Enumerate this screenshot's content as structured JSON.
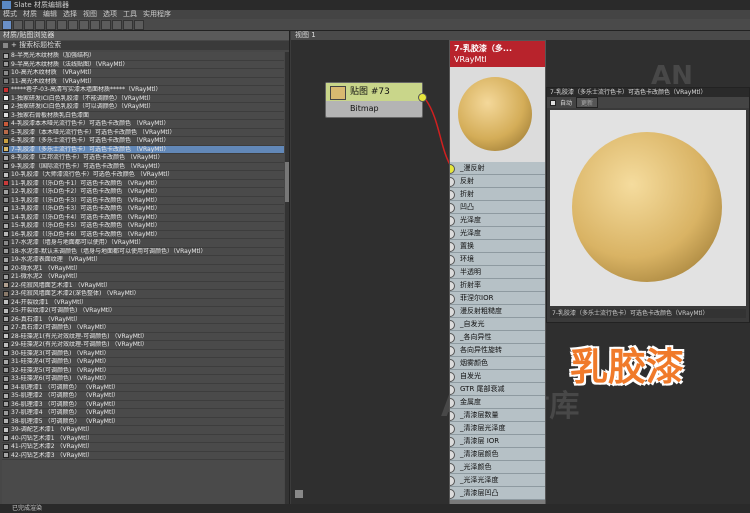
{
  "window": {
    "title": "Slate 材质编辑器"
  },
  "menu": [
    "模式",
    "材质",
    "编辑",
    "选择",
    "视图",
    "选项",
    "工具",
    "实用程序"
  ],
  "left_panel": {
    "title": "材质/贴图浏览器",
    "section": "+ 搜索标题检索",
    "items": [
      {
        "label": "8-半亮光木纹材质（加强结构）",
        "swatch": "#aaaaaa"
      },
      {
        "label": "9-半高光木纹材质（法线贴图）（VRayMtl）",
        "swatch": "#999999"
      },
      {
        "label": "10-高光木纹材质 （VRayMtl）",
        "swatch": "#8a8a8a"
      },
      {
        "label": "11-高光木纹材质 （VRayMtl）",
        "swatch": "#7a7a7a"
      },
      {
        "label": "*****巷子-03-高清写实漆木墙面材质*****（VRayMtl）",
        "swatch": "#c83030"
      },
      {
        "label": "1-独家研发ICI白色乳胶漆（不能调颜色）（VRayMtl）",
        "swatch": "#eeeeee"
      },
      {
        "label": "2-独家研发ICI白色乳胶漆（可以调颜色）（VRayMtl）",
        "swatch": "#e4e4e4"
      },
      {
        "label": "3-独家石膏板材质乳白色漆面",
        "swatch": "#dddddd"
      },
      {
        "label": "4-乳胶漆本木哑光流行色卡）可选色卡改颜色 （VRayMtl）",
        "swatch": "#c85a3a"
      },
      {
        "label": "5-乳胶漆（本木哑光流行色卡）可选色卡改颜色 （VRayMtl）",
        "swatch": "#b86a4a"
      },
      {
        "label": "6-乳胶漆（多乐士流行色卡）可选色卡改颜色 （VRayMtl）",
        "swatch": "#c9a040"
      },
      {
        "label": "7-乳胶漆（多乐士流行色卡）可选色卡改颜色 （VRayMtl）",
        "swatch": "#d8b868",
        "selected": true
      },
      {
        "label": "8-乳胶漆（立邦流行色卡）可选色卡改颜色 （VRayMtl）",
        "swatch": "#a8a8a8"
      },
      {
        "label": "9-乳胶漆（国际流行色卡）可选色卡改颜色 （VRayMtl）",
        "swatch": "#b0b0b0"
      },
      {
        "label": "10-乳胶漆（大师漆流行色卡）可选色卡改颜色 （VRayMtl）",
        "swatch": "#c0c0c0"
      },
      {
        "label": "11-乳胶漆（（乐D色卡1）可选色卡改颜色 （VRayMtl）",
        "swatch": "#c83a3a"
      },
      {
        "label": "12-乳胶漆（（乐D色卡2）可选色卡改颜色 （VRayMtl）",
        "swatch": "#a0a0a0"
      },
      {
        "label": "13-乳胶漆（（乐D色卡3）可选色卡改颜色 （VRayMtl）",
        "swatch": "#909090"
      },
      {
        "label": "13-乳胶漆（（乐D色卡3）可选色卡改颜色 （VRayMtl）",
        "swatch": "#bbbbbb"
      },
      {
        "label": "14-乳胶漆（（乐D色卡4）可选色卡改颜色 （VRayMtl）",
        "swatch": "#9a9a9a"
      },
      {
        "label": "15-乳胶漆（（乐D色卡5）可选色卡改颜色 （VRayMtl）",
        "swatch": "#aaaaaa"
      },
      {
        "label": "16-乳胶漆（（乐D色卡6）可选色卡改颜色 （VRayMtl）",
        "swatch": "#b8b8b8"
      },
      {
        "label": "17-水泥漆（墙身与地面都可以使用）（VRayMtl）",
        "swatch": "#888888"
      },
      {
        "label": "18-水泥漆-默认未调颜色（墙身与地面都可以使用可调颜色）（VRayMtl）",
        "swatch": "#999999"
      },
      {
        "label": "19-水泥漆表面纹理 （VRayMtl）",
        "swatch": "#a5a5a5"
      },
      {
        "label": "20-微水泥1 （VRayMtl）",
        "swatch": "#aaaaaa"
      },
      {
        "label": "21-微水泥2 （VRayMtl）",
        "swatch": "#9e9e9e"
      },
      {
        "label": "22-侘寂风墙面艺术漆1 （VRayMtl）",
        "swatch": "#b0a090"
      },
      {
        "label": "23-侘寂风墙面艺术漆2(深色整体) （VRayMtl）",
        "swatch": "#8a7a6a"
      },
      {
        "label": "24-开裂纹漆1 （VRayMtl）",
        "swatch": "#c0c0c0"
      },
      {
        "label": "25-开裂纹漆2(可调颜色) （VRayMtl）",
        "swatch": "#bcbcbc"
      },
      {
        "label": "26-真石漆1 （VRayMtl）",
        "swatch": "#a9a9a9"
      },
      {
        "label": "27-真石漆2(可调颜色) （VRayMtl）",
        "swatch": "#b4b4b4"
      },
      {
        "label": "28-硅藻泥1(有光对效纹理-可调颜色) （VRayMtl）",
        "swatch": "#c4c4c4"
      },
      {
        "label": "29-硅藻泥2(有光对效纹理-可调颜色) （VRayMtl）",
        "swatch": "#bdbdbd"
      },
      {
        "label": "30-硅藻泥3(可调颜色) （VRayMtl）",
        "swatch": "#b0b0b0"
      },
      {
        "label": "31-硅藻泥4(可调颜色) （VRayMtl）",
        "swatch": "#a8a8a8"
      },
      {
        "label": "32-硅藻泥5(可调颜色) （VRayMtl）",
        "swatch": "#9c9c9c"
      },
      {
        "label": "33-硅藻泥6(可调颜色) （VRayMtl）",
        "swatch": "#a2a2a2"
      },
      {
        "label": "34-肌理漆1 （可调颜色） （VRayMtl）",
        "swatch": "#b6b6b6"
      },
      {
        "label": "35-肌理漆2 （可调颜色） （VRayMtl）",
        "swatch": "#acacac"
      },
      {
        "label": "36-肌理漆3 （可调颜色） （VRayMtl）",
        "swatch": "#a0a0a0"
      },
      {
        "label": "37-肌理漆4 （可调颜色） （VRayMtl）",
        "swatch": "#9a9a9a"
      },
      {
        "label": "38-肌理漆5 （可调颜色） （VRayMtl）",
        "swatch": "#b2b2b2"
      },
      {
        "label": "39-调配艺术漆1 （VRayMtl）",
        "swatch": "#c6c6c6"
      },
      {
        "label": "40-闪钻艺术漆1 （VRayMtl）",
        "swatch": "#bababa"
      },
      {
        "label": "41-闪钻艺术漆2 （VRayMtl）",
        "swatch": "#aeaeae"
      },
      {
        "label": "42-闪钻艺术漆3 （VRayMtl）",
        "swatch": "#a4a4a4"
      }
    ]
  },
  "view": {
    "tab": "视图 1"
  },
  "bitmap_node": {
    "title": "贴图 #73",
    "type": "Bitmap"
  },
  "material_node": {
    "title": "7-乳胶漆（多...",
    "type": "VRayMtl",
    "slots": [
      "_漫反射",
      "反射",
      "折射",
      "凹凸",
      "光泽度",
      "光泽度",
      "置换",
      "环境",
      "半透明",
      "折射率",
      "菲涅尔IOR",
      "漫反射粗糙度",
      "_自发光",
      "_各向异性",
      "各向异性旋转",
      "烟雾颜色",
      "自发光",
      "GTR 尾部衰减",
      "金属度",
      "_清漆层数量",
      "_清漆层光泽度",
      "_清漆层 IOR",
      "_清漆层颜色",
      "_光泽颜色",
      "_光泽光泽度",
      "_清漆层凹凸"
    ]
  },
  "preview_window": {
    "title": "7-乳胶漆（多乐士流行色卡）可选色卡改颜色（VRayMtl）",
    "auto_label": "自动",
    "update_label": "更新",
    "footer": "7-乳胶漆（多乐士流行色卡）可选色卡改颜色（VRayMtl）"
  },
  "overlay_text": "乳胶漆",
  "status": {
    "text": "已完成渲染"
  },
  "colors": {
    "accent": "#6288b8",
    "material_header": "#b8232c",
    "port": "#e6e63c",
    "wire": "#d02020"
  }
}
